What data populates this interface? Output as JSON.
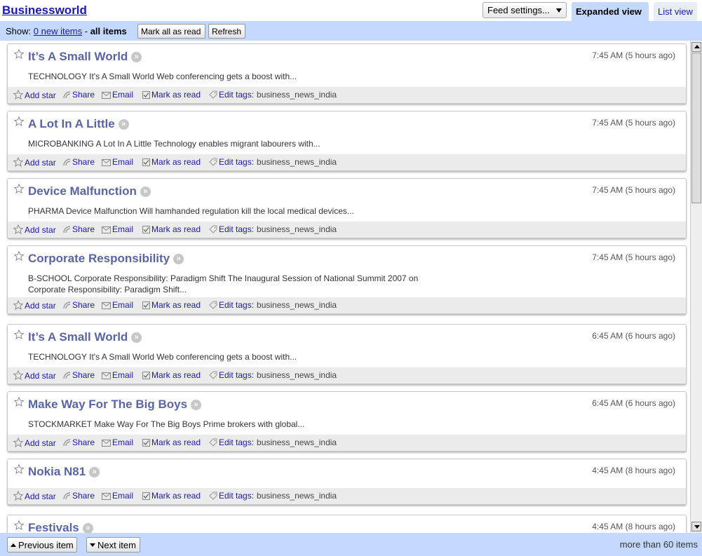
{
  "header": {
    "feed_title": "Businessworld",
    "feed_settings_label": "Feed settings...",
    "tabs": [
      {
        "label": "Expanded view",
        "active": true
      },
      {
        "label": "List view",
        "active": false
      }
    ]
  },
  "toolbar": {
    "show_label": "Show:",
    "new_items_label": "0 new items",
    "separator": " - ",
    "all_items_label": "all items",
    "mark_all_read_label": "Mark all as read",
    "refresh_label": "Refresh"
  },
  "action_labels": {
    "add_star": "Add star",
    "share": "Share",
    "email": "Email",
    "mark_as_read": "Mark as read",
    "edit_tags": "Edit tags:"
  },
  "entries": [
    {
      "title": "It’s A Small World",
      "time": "7:45 AM (5 hours ago)",
      "snippet": "TECHNOLOGY It's A Small World Web conferencing gets a boost with...",
      "tags": "business_news_india"
    },
    {
      "title": "A Lot In A Little",
      "time": "7:45 AM (5 hours ago)",
      "snippet": "MICROBANKING A Lot In A Little Technology enables migrant labourers with...",
      "tags": "business_news_india"
    },
    {
      "title": "Device Malfunction",
      "time": "7:45 AM (5 hours ago)",
      "snippet": "PHARMA Device Malfunction Will hamhanded regulation kill the local medical devices...",
      "tags": "business_news_india"
    },
    {
      "title": "Corporate Responsibility",
      "time": "7:45 AM (5 hours ago)",
      "snippet": "B-SCHOOL Corporate Responsibility: Paradigm Shift The Inaugural Session of National Summit 2007 on Corporate Responsibility: Paradigm Shift...",
      "tags": "business_news_india"
    },
    {
      "title": "It’s A Small World",
      "time": "6:45 AM (6 hours ago)",
      "snippet": "TECHNOLOGY It's A Small World Web conferencing gets a boost with...",
      "tags": "business_news_india"
    },
    {
      "title": "Make Way For The Big Boys",
      "time": "6:45 AM (6 hours ago)",
      "snippet": "STOCKMARKET Make Way For The Big Boys Prime brokers with global...",
      "tags": "business_news_india"
    },
    {
      "title": "Nokia N81",
      "time": "4:45 AM (8 hours ago)",
      "snippet": "",
      "tags": "business_news_india"
    },
    {
      "title": "Festivals",
      "time": "4:45 AM (8 hours ago)",
      "snippet": "",
      "tags": ""
    }
  ],
  "footer": {
    "previous_label": "Previous item",
    "next_label": "Next item",
    "item_count": "more than 60 items"
  },
  "colors": {
    "toolbar_bg": "#c3d9ff",
    "title_color": "#5a65a0",
    "link_color": "#1a1aa6",
    "action_bar_bg": "#ebebeb"
  }
}
